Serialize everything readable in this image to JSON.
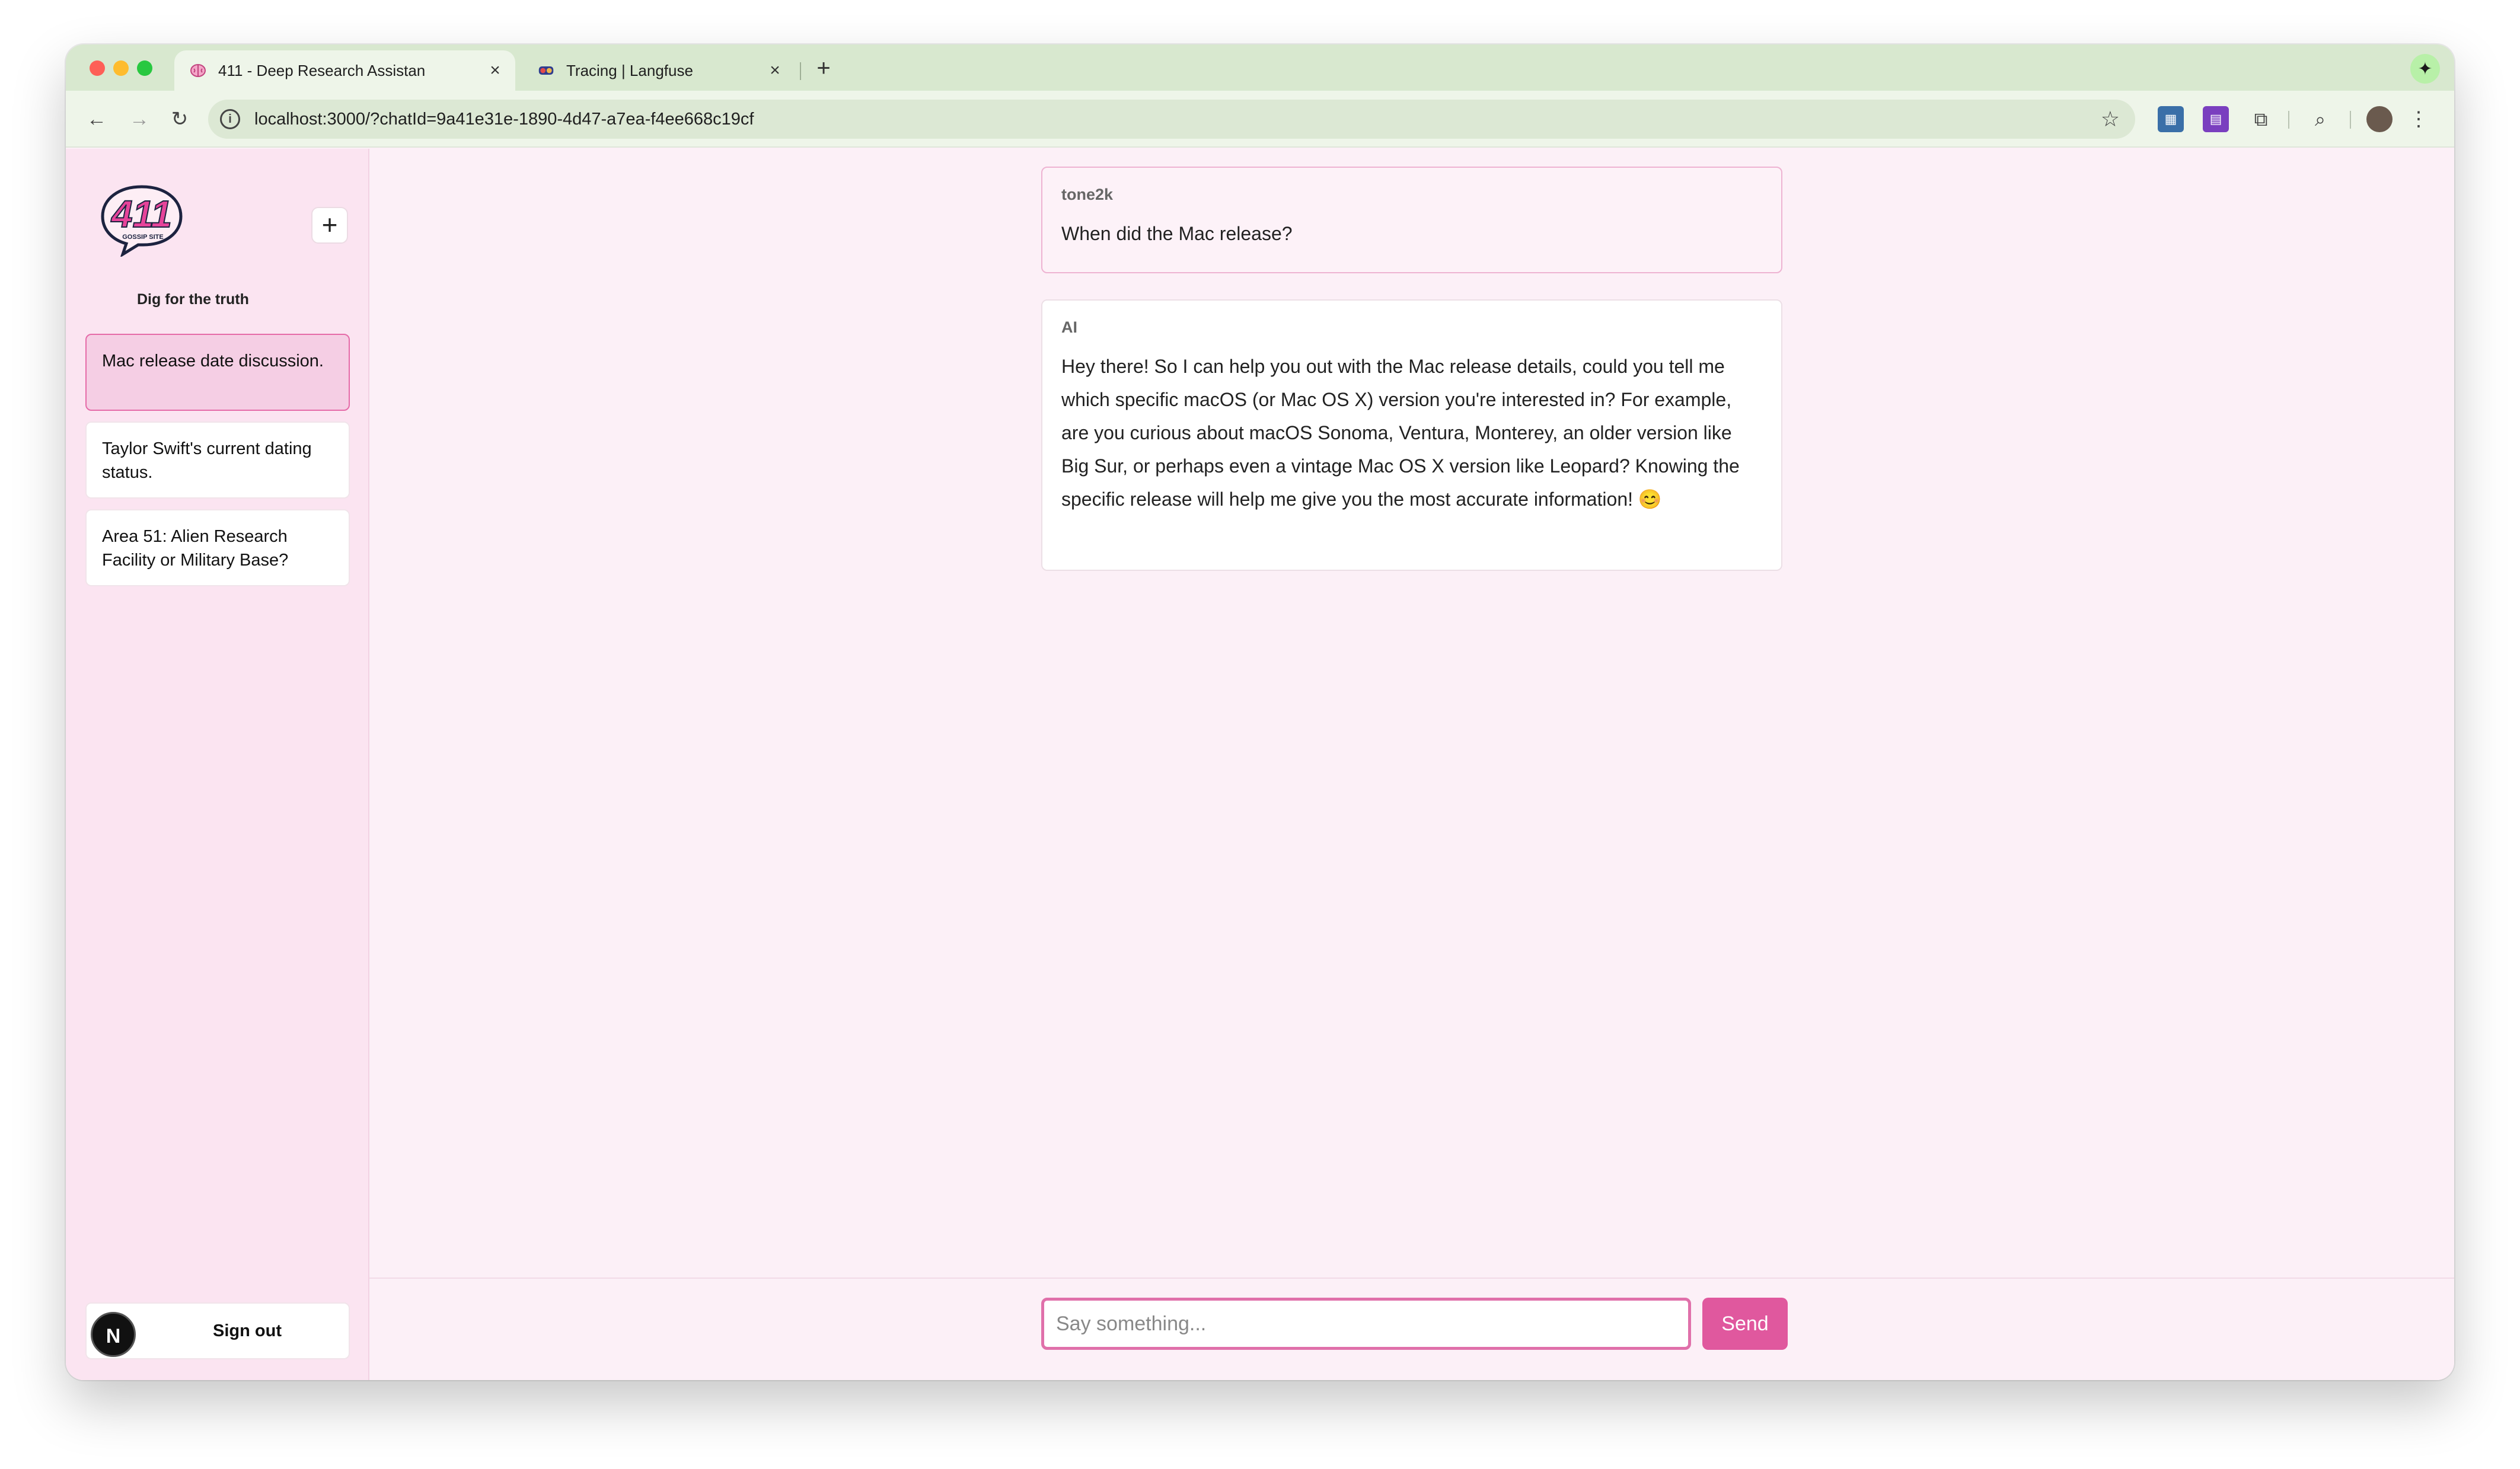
{
  "browser": {
    "tabs": [
      {
        "title": "411 - Deep Research Assistan",
        "favicon": "brain-icon",
        "active": true,
        "close": "×"
      },
      {
        "title": "Tracing | Langfuse",
        "favicon": "langfuse-icon",
        "active": false,
        "close": "×"
      }
    ],
    "new_tab": "+",
    "url": "localhost:3000/?chatId=9a41e31e-1890-4d47-a7ea-f4ee668c19cf",
    "icons": {
      "back": "←",
      "forward": "→",
      "reload": "↻",
      "site_info": "i",
      "star": "☆",
      "extensions": "⧉",
      "menu": "⋮",
      "gemini": "✦",
      "tab_search": "⌕"
    }
  },
  "sidebar": {
    "logo_text": "411",
    "logo_subtext": "GOSSIP SITE",
    "new_chat": "+",
    "tagline": "Dig for the truth",
    "chats": [
      {
        "title": "Mac release date discussion.",
        "active": true
      },
      {
        "title": "Taylor Swift's current dating status.",
        "active": false
      },
      {
        "title": "Area 51: Alien Research Facility or Military Base?",
        "active": false
      }
    ],
    "user_initial": "N",
    "sign_out": "Sign out"
  },
  "messages": [
    {
      "author": "tone2k",
      "text": "When did the Mac release?"
    },
    {
      "author": "AI",
      "text": "Hey there! So I can help you out with the Mac release details, could you tell me which specific macOS (or Mac OS X) version you're interested in? For example, are you curious about macOS Sonoma, Ventura, Monterey, an older version like Big Sur, or perhaps even a vintage Mac OS X version like Leopard? Knowing the specific release will help me give you the most accurate information! 😊"
    }
  ],
  "composer": {
    "placeholder": "Say something...",
    "send": "Send"
  },
  "colors": {
    "accent": "#e0589e",
    "sidebar_bg": "#fbe4f1",
    "active_chat_bg": "#f5cee4"
  }
}
